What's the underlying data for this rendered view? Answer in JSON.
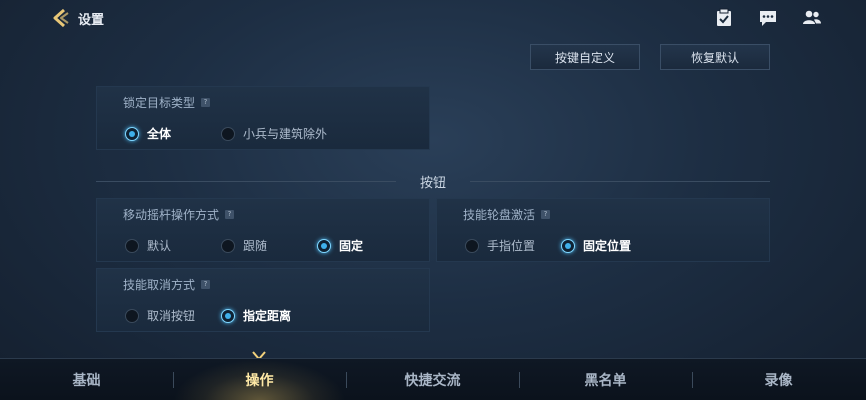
{
  "header": {
    "title": "设置",
    "icons": [
      "back-arrow-icon",
      "clipboard-icon",
      "chat-icon",
      "friends-icon"
    ]
  },
  "actions": {
    "custom_keys": "按键自定义",
    "restore_default": "恢复默认"
  },
  "lock_target": {
    "title": "锁定目标类型",
    "options": [
      "全体",
      "小兵与建筑除外"
    ],
    "selected": "全体"
  },
  "section": {
    "title": "按钮"
  },
  "joystick": {
    "title": "移动摇杆操作方式",
    "options": [
      "默认",
      "跟随",
      "固定"
    ],
    "selected": "固定"
  },
  "skill_wheel": {
    "title": "技能轮盘激活",
    "options": [
      "手指位置",
      "固定位置"
    ],
    "selected": "固定位置"
  },
  "skill_cancel": {
    "title": "技能取消方式",
    "options": [
      "取消按钮",
      "指定距离"
    ],
    "selected": "指定距离"
  },
  "tabs": [
    {
      "label": "基础"
    },
    {
      "label": "操作"
    },
    {
      "label": "快捷交流"
    },
    {
      "label": "黑名单"
    },
    {
      "label": "录像"
    }
  ],
  "active_tab": "操作",
  "colors": {
    "accent_blue": "#3fb0ea",
    "active_tab_gold": "#ffe9a6",
    "background": "#1d2e43"
  }
}
